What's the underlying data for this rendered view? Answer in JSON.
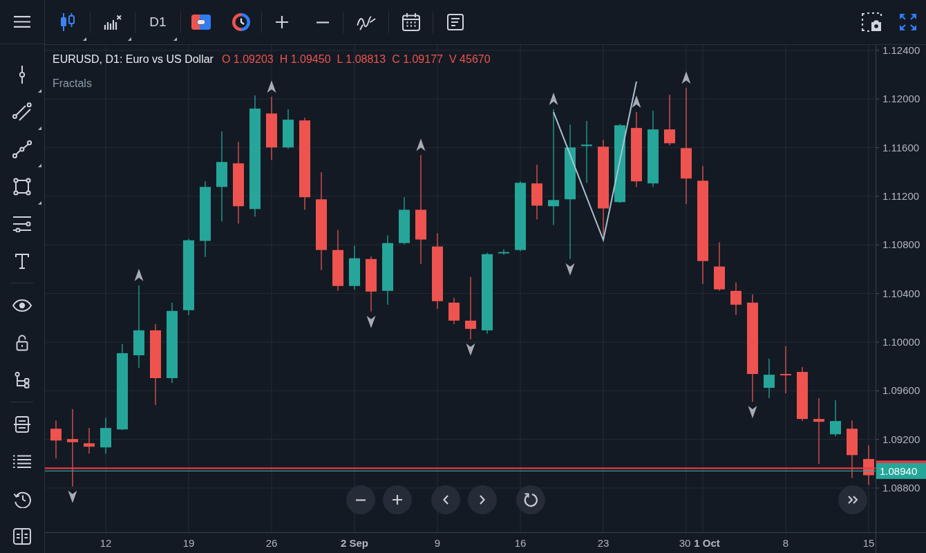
{
  "toolbar": {
    "timeframe": "D1"
  },
  "chart": {
    "title": "EURUSD, D1: Euro vs US Dollar",
    "ohlc": [
      "O 1.09203",
      "H 1.09450",
      "L 1.08813",
      "C 1.09177",
      "V 45670"
    ],
    "xtick_bold": [
      false,
      false,
      false,
      true,
      false,
      false,
      false,
      false,
      true,
      false,
      false
    ],
    "chart_data": {
      "type": "candlestick",
      "categories": [
        null,
        null,
        null,
        "12",
        null,
        null,
        null,
        null,
        "19",
        null,
        null,
        null,
        null,
        "26",
        null,
        null,
        null,
        null,
        "2 Sep",
        null,
        null,
        null,
        null,
        "9",
        null,
        null,
        null,
        null,
        "16",
        null,
        null,
        null,
        null,
        "23",
        null,
        null,
        null,
        null,
        "30",
        "1 Oct",
        null,
        null,
        null,
        null,
        "8",
        null,
        null,
        null,
        null,
        "15"
      ],
      "ohlc": [
        [
          1.09288,
          1.09356,
          1.09043,
          1.09191
        ],
        [
          1.09203,
          1.0945,
          1.08813,
          1.09177
        ],
        [
          1.09168,
          1.09294,
          1.09083,
          1.0914
        ],
        [
          1.09134,
          1.09379,
          1.09083,
          1.09294
        ],
        [
          1.09282,
          1.09983,
          1.09276,
          1.09909
        ],
        [
          1.09892,
          1.10468,
          1.09789,
          1.10097
        ],
        [
          1.10097,
          1.10149,
          1.09482,
          1.09704
        ],
        [
          1.09704,
          1.10325,
          1.09664,
          1.10257
        ],
        [
          1.10263,
          1.1085,
          1.10223,
          1.10838
        ],
        [
          1.10833,
          1.11323,
          1.10701,
          1.11277
        ],
        [
          1.11277,
          1.11733,
          1.10992,
          1.11482
        ],
        [
          1.11471,
          1.11648,
          1.10975,
          1.11118
        ],
        [
          1.11095,
          1.1203,
          1.11032,
          1.11921
        ],
        [
          1.11881,
          1.12018,
          1.11499,
          1.11602
        ],
        [
          1.11602,
          1.11916,
          1.11591,
          1.1183
        ],
        [
          1.11824,
          1.11847,
          1.11089,
          1.11192
        ],
        [
          1.11175,
          1.11397,
          1.10593,
          1.10758
        ],
        [
          1.10758,
          1.10924,
          1.10422,
          1.10462
        ],
        [
          1.10462,
          1.10793,
          1.10434,
          1.1069
        ],
        [
          1.10684,
          1.10707,
          1.10251,
          1.10416
        ],
        [
          1.10422,
          1.10878,
          1.10308,
          1.10815
        ],
        [
          1.10815,
          1.11192,
          1.10804,
          1.11089
        ],
        [
          1.11089,
          1.11539,
          1.10644,
          1.10844
        ],
        [
          1.10787,
          1.10895,
          1.10274,
          1.10337
        ],
        [
          1.10325,
          1.10365,
          1.10149,
          1.10177
        ],
        [
          1.10177,
          1.10536,
          1.10023,
          1.10109
        ],
        [
          1.10097,
          1.10736,
          1.10069,
          1.10724
        ],
        [
          1.1073,
          1.10764,
          1.10719,
          1.10741
        ],
        [
          1.10758,
          1.11323,
          1.10747,
          1.11311
        ],
        [
          1.11306,
          1.1146,
          1.11009,
          1.11123
        ],
        [
          1.11118,
          1.11916,
          1.10964,
          1.11169
        ],
        [
          1.11175,
          1.1179,
          1.10684,
          1.11602
        ],
        [
          1.11613,
          1.11819,
          1.11311,
          1.11625
        ],
        [
          1.11608,
          1.11665,
          1.10878,
          1.111
        ],
        [
          1.11152,
          1.11796,
          1.11146,
          1.11784
        ],
        [
          1.11762,
          1.11893,
          1.11277,
          1.11323
        ],
        [
          1.11306,
          1.11904,
          1.11277,
          1.1175
        ],
        [
          1.1175,
          1.12035,
          1.11619,
          1.11636
        ],
        [
          1.11596,
          1.12092,
          1.11135,
          1.11346
        ],
        [
          1.11328,
          1.11448,
          1.10479,
          1.10667
        ],
        [
          1.10622,
          1.10821,
          1.10422,
          1.10434
        ],
        [
          1.10422,
          1.10491,
          1.10223,
          1.10308
        ],
        [
          1.10325,
          1.10394,
          1.0951,
          1.09738
        ],
        [
          1.09624,
          1.09864,
          1.09539,
          1.09732
        ],
        [
          1.09738,
          1.09966,
          1.09579,
          1.09727
        ],
        [
          1.09755,
          1.09795,
          1.09351,
          1.09368
        ],
        [
          1.09368,
          1.09539,
          1.08997,
          1.09345
        ],
        [
          1.09242,
          1.09522,
          1.09225,
          1.09351
        ],
        [
          1.09288,
          1.09356,
          1.08883,
          1.09071
        ],
        [
          1.09039,
          1.09151,
          1.08826,
          1.08905
        ]
      ],
      "series": [
        {
          "name": "Fractals",
          "type": "scatter",
          "color": "#a9acb4",
          "values": [
            null,
            1.08728,
            null,
            null,
            null,
            1.10553,
            null,
            null,
            null,
            null,
            null,
            null,
            null,
            1.12103,
            null,
            null,
            null,
            null,
            null,
            1.10166,
            null,
            null,
            1.11624,
            null,
            null,
            1.09938,
            null,
            null,
            null,
            null,
            1.12001,
            1.10599,
            null,
            null,
            null,
            1.11978,
            null,
            null,
            1.12177,
            null,
            null,
            null,
            1.09425,
            null,
            null,
            null,
            null,
            null,
            null,
            null
          ]
        },
        {
          "type": "line",
          "color": "#a7c3d2",
          "values": [
            null,
            null,
            null,
            null,
            null,
            null,
            null,
            null,
            null,
            null,
            null,
            null,
            null,
            null,
            null,
            null,
            null,
            null,
            null,
            null,
            null,
            null,
            null,
            null,
            null,
            null,
            null,
            null,
            null,
            null,
            1.11893,
            null,
            null,
            1.10841,
            null,
            1.12144,
            null,
            null,
            null,
            null,
            null,
            null,
            null,
            null,
            null,
            null,
            null,
            null,
            null,
            null
          ]
        }
      ],
      "ylim": [
        1.08436,
        1.12445
      ],
      "yticks": [
        {
          "value": 1.124,
          "label": "1.12400"
        },
        {
          "value": 1.12,
          "label": "1.12000"
        },
        {
          "value": 1.116,
          "label": "1.11600"
        },
        {
          "value": 1.112,
          "label": "1.11200"
        },
        {
          "value": 1.108,
          "label": "1.10800"
        },
        {
          "value": 1.104,
          "label": "1.10400"
        },
        {
          "value": 1.1,
          "label": "1.10000"
        },
        {
          "value": 1.096,
          "label": "1.09600"
        },
        {
          "value": 1.092,
          "label": "1.09200"
        },
        {
          "value": 1.088,
          "label": "1.08800"
        }
      ],
      "grid": true,
      "ref_lines": [
        {
          "axis": "y",
          "value": 1.08963,
          "color": "#f23645"
        },
        {
          "axis": "y",
          "value": 1.0894,
          "label": "1.08940",
          "color": "#26a69a"
        }
      ]
    }
  }
}
